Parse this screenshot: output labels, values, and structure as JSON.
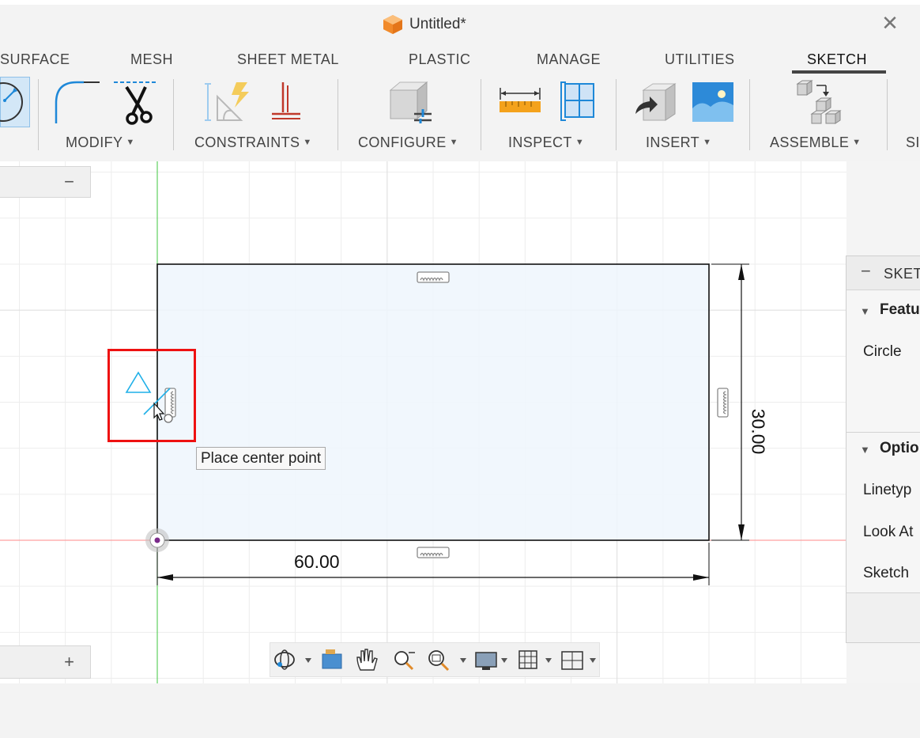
{
  "window": {
    "title": "Untitled*",
    "close_glyph": "✕",
    "app_icon": "orange-cube-icon"
  },
  "tabs": [
    {
      "label": "SURFACE"
    },
    {
      "label": "MESH"
    },
    {
      "label": "SHEET METAL"
    },
    {
      "label": "PLASTIC"
    },
    {
      "label": "MANAGE"
    },
    {
      "label": "UTILITIES"
    },
    {
      "label": "SKETCH",
      "active": true
    }
  ],
  "toolbar": {
    "groups": [
      {
        "label": "MODIFY"
      },
      {
        "label": "CONSTRAINTS"
      },
      {
        "label": "CONFIGURE"
      },
      {
        "label": "INSPECT"
      },
      {
        "label": "INSERT"
      },
      {
        "label": "ASSEMBLE"
      },
      {
        "label": "SI"
      }
    ],
    "caret": "▼"
  },
  "browser": {
    "collapse_glyph": "−"
  },
  "comments": {
    "expand_glyph": "+"
  },
  "canvas": {
    "tooltip": "Place center point",
    "dimension_width": "60.00",
    "dimension_height": "30.00"
  },
  "palette": {
    "header": "SKETCH",
    "collapse_glyph": "−",
    "section_features": "Featu",
    "feature_circle": "Circle",
    "section_options": "Optio",
    "option_linetype": "Linetyp",
    "option_lookat": "Look At",
    "option_sketch": "Sketch"
  },
  "colors": {
    "accent_blue": "#1e88d8",
    "sketch_fill": "#eef6fd",
    "highlight_red": "#e11111",
    "axis_green": "#3fc43f",
    "axis_red": "#ff7a7a",
    "app_orange": "#f08a24"
  }
}
